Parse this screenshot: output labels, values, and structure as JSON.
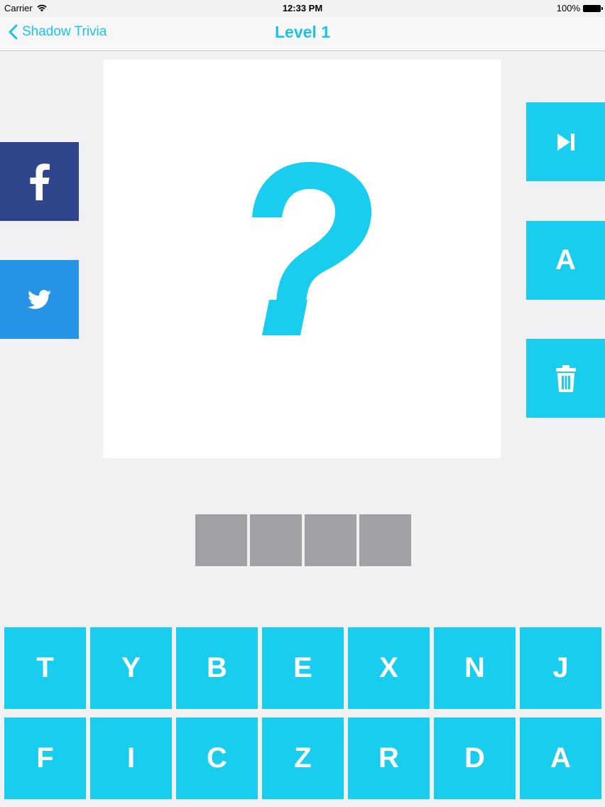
{
  "status_bar": {
    "carrier": "Carrier",
    "time": "12:33 PM",
    "battery": "100%"
  },
  "nav": {
    "back_label": "Shadow Trivia",
    "title": "Level 1"
  },
  "image_card": {
    "placeholder": "?"
  },
  "side_buttons": {
    "facebook_icon": "facebook-icon",
    "twitter_icon": "twitter-icon",
    "skip_icon": "skip-forward-icon",
    "reveal_label": "A",
    "delete_icon": "trash-icon"
  },
  "answer": {
    "slots": [
      "",
      "",
      "",
      ""
    ]
  },
  "keyboard": {
    "keys": [
      "T",
      "Y",
      "B",
      "E",
      "X",
      "N",
      "J",
      "F",
      "I",
      "C",
      "Z",
      "R",
      "D",
      "A"
    ]
  },
  "colors": {
    "accent": "#19cdee",
    "facebook": "#2f468d",
    "twitter": "#2694e6",
    "slot": "#a0a0a5"
  }
}
